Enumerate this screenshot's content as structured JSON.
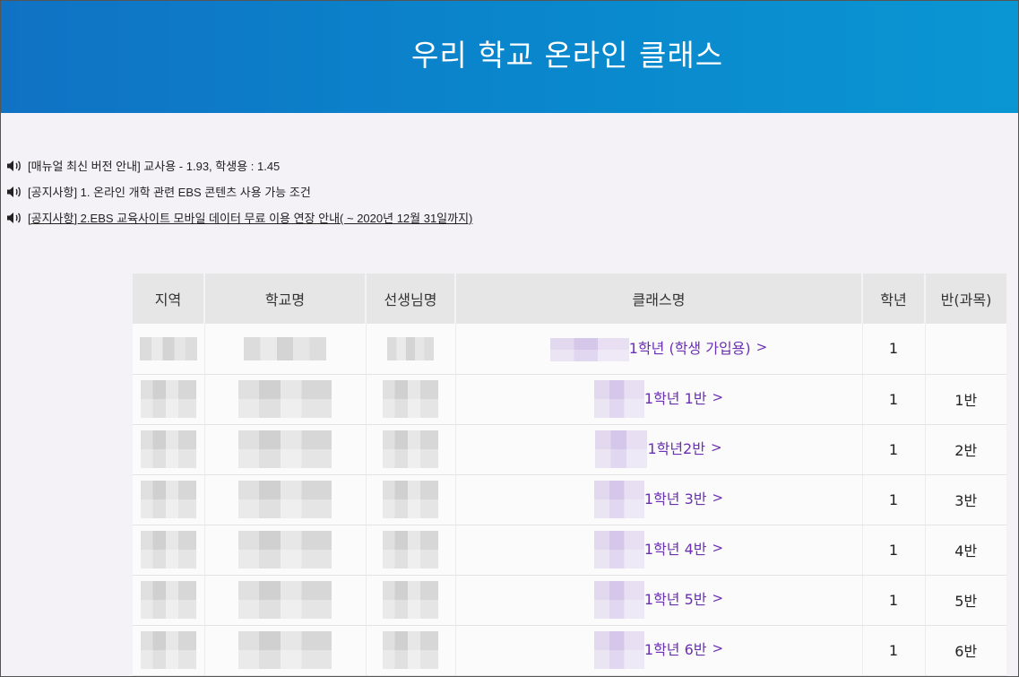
{
  "header": {
    "title": "우리 학교 온라인 클래스"
  },
  "notices": [
    {
      "text": "[매뉴얼 최신 버전 안내] 교사용 - 1.93, 학생용 : 1.45",
      "icon": "speaker-icon"
    },
    {
      "text": "[공지사항] 1. 온라인 개학 관련 EBS 콘텐츠 사용 가능 조건",
      "icon": "speaker-icon"
    },
    {
      "text": "[공지사항] 2.EBS 교육사이트 모바일 데이터 무료 이용 연장 안내( ~ 2020년 12월 31일까지)",
      "icon": "speaker-icon"
    }
  ],
  "table": {
    "columns": [
      "지역",
      "학교명",
      "선생님명",
      "클래스명",
      "학년",
      "반(과목)"
    ],
    "rows": [
      {
        "class_name": "1학년 (학생 가입용)",
        "grade": "1",
        "section": ""
      },
      {
        "class_name": "1학년 1반",
        "grade": "1",
        "section": "1반"
      },
      {
        "class_name": "1학년2반",
        "grade": "1",
        "section": "2반"
      },
      {
        "class_name": "1학년 3반",
        "grade": "1",
        "section": "3반"
      },
      {
        "class_name": "1학년 4반",
        "grade": "1",
        "section": "4반"
      },
      {
        "class_name": "1학년 5반",
        "grade": "1",
        "section": "5반"
      },
      {
        "class_name": "1학년 6반",
        "grade": "1",
        "section": "6반"
      }
    ]
  },
  "colors": {
    "banner_start": "#1072c4",
    "banner_end": "#0a96d3",
    "link": "#6b2fb3",
    "page_bg": "#f4f2f7"
  }
}
